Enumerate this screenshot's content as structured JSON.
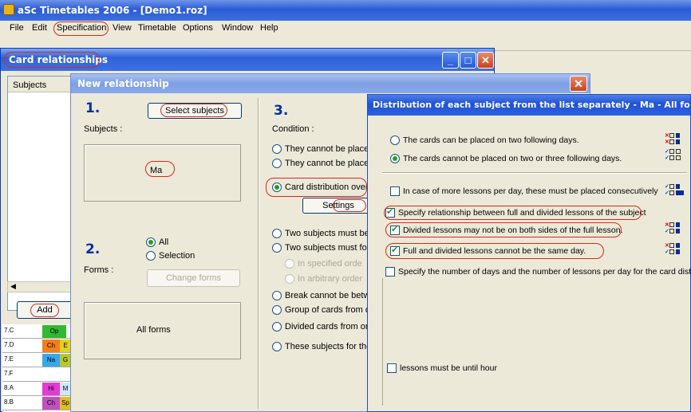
{
  "app": {
    "title": "aSc Timetables 2006  - [Demo1.roz]"
  },
  "menu": {
    "items": [
      {
        "label": "File"
      },
      {
        "label": "Edit"
      },
      {
        "label": "Specification"
      },
      {
        "label": "View"
      },
      {
        "label": "Timetable"
      },
      {
        "label": "Options"
      },
      {
        "label": "Window"
      },
      {
        "label": "Help"
      }
    ]
  },
  "card_relationships": {
    "title": "Card relationships",
    "subjects_header": "Subjects",
    "add_button": "Add"
  },
  "timetable": {
    "rows": [
      {
        "label": "7.C",
        "cells": [
          {
            "text": "Op",
            "color": "#33b833"
          }
        ]
      },
      {
        "label": "7.D",
        "cells": [
          {
            "text": "Ch",
            "color": "#f27f1b"
          },
          {
            "text": "E",
            "color": "#e0d21a"
          }
        ]
      },
      {
        "label": "7.E",
        "cells": [
          {
            "text": "Na",
            "color": "#3aa7e8"
          },
          {
            "text": "G",
            "color": "#b8c830"
          }
        ]
      },
      {
        "label": "7.F",
        "cells": []
      },
      {
        "label": "8.A",
        "cells": [
          {
            "text": "Hi",
            "color": "#e23bd8"
          },
          {
            "text": "M",
            "color": "#d0e8ff"
          }
        ]
      },
      {
        "label": "8.B",
        "cells": [
          {
            "text": "Ch",
            "color": "#c050c0"
          },
          {
            "text": "Sp",
            "color": "#e0c020"
          }
        ]
      }
    ]
  },
  "new_relationship": {
    "title": "New relationship",
    "step1": "1.",
    "select_subjects_button": "Select subjects",
    "subjects_label": "Subjects :",
    "selected_subject": "Ma",
    "step2": "2.",
    "forms_label": "Forms :",
    "forms_all": "All",
    "forms_selection": "Selection",
    "change_forms_button": "Change forms",
    "forms_value": "All forms",
    "step3": "3.",
    "condition_label": "Condition :",
    "conditions": [
      "They cannot be placed",
      "They cannot be placed",
      "Card distribution over the",
      "Two subjects must be in",
      "Two subjects must follow",
      "In specified orde",
      "In arbitrary order",
      "Break cannot be betwee",
      "Group of cards from diffe",
      "Divided cards from one",
      "These subjects for the g"
    ],
    "settings_button": "Settings"
  },
  "distribution": {
    "title": "Distribution of each subject from the list separately - Ma - All forms",
    "radio_two_days": "The cards can be placed on two following days.",
    "radio_not_two_three": "The cards cannot be placed on two or three following days.",
    "consecutive": "In case of more lessons per day, these must be placed consecutively",
    "specify_relationship": "Specify relationship between full and divided lessons of the subject",
    "divided_not_both": "Divided lessons may not be on both sides of the full lesson.",
    "full_divided_same_day": "Full and divided lessons cannot be the same day.",
    "specify_days": "Specify the number of days and the number of lessons per day for the card distributi",
    "until_hour": "lessons must be until hour"
  },
  "colors": {
    "highlight_red": "#d8281e",
    "xp_blue": "#2a5bd7"
  }
}
